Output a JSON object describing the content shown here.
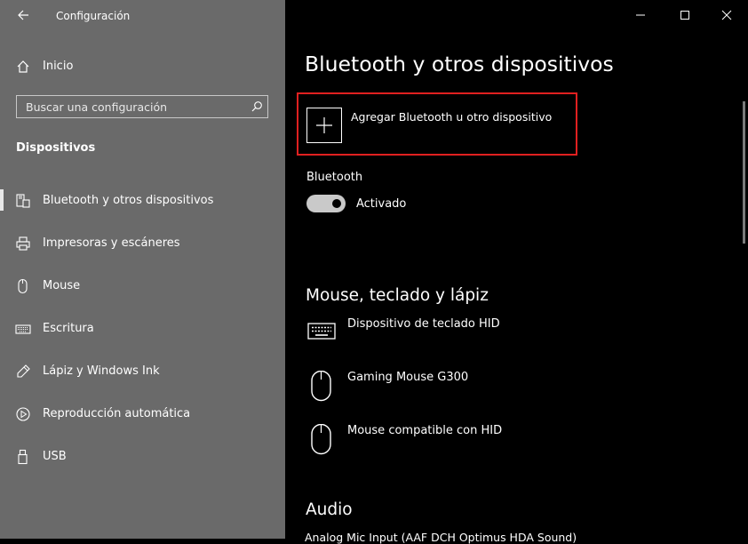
{
  "app": {
    "title": "Configuración",
    "back_icon": "back-arrow-icon",
    "window_controls": [
      "minimize-icon",
      "maximize-icon",
      "close-icon"
    ]
  },
  "sidebar": {
    "home_label": "Inicio",
    "search": {
      "placeholder": "Buscar una configuración",
      "value": ""
    },
    "section_header": "Dispositivos",
    "items": [
      {
        "label": "Bluetooth y otros dispositivos",
        "icon": "bluetooth-devices-icon",
        "selected": true
      },
      {
        "label": "Impresoras y escáneres",
        "icon": "printer-icon",
        "selected": false
      },
      {
        "label": "Mouse",
        "icon": "mouse-icon",
        "selected": false
      },
      {
        "label": "Escritura",
        "icon": "keyboard-icon",
        "selected": false
      },
      {
        "label": "Lápiz y Windows Ink",
        "icon": "pen-icon",
        "selected": false
      },
      {
        "label": "Reproducción automática",
        "icon": "autoplay-icon",
        "selected": false
      },
      {
        "label": "USB",
        "icon": "usb-icon",
        "selected": false
      }
    ]
  },
  "main": {
    "page_title": "Bluetooth y otros dispositivos",
    "add_device_label": "Agregar Bluetooth u otro dispositivo",
    "bluetooth_label": "Bluetooth",
    "bluetooth_state": "Activado",
    "bluetooth_on": true,
    "groups": {
      "input_title": "Mouse, teclado y lápiz",
      "devices": [
        {
          "name": "Dispositivo de teclado HID",
          "icon": "keyboard-icon"
        },
        {
          "name": "Gaming Mouse G300",
          "icon": "mouse-icon"
        },
        {
          "name": "Mouse compatible con HID",
          "icon": "mouse-icon"
        }
      ],
      "audio_title": "Audio",
      "audio_partial": "Analog Mic Input (AAF DCH Optimus HDA Sound)"
    }
  },
  "colors": {
    "sidebar_bg": "#6a6a6a",
    "main_bg": "#000000",
    "highlight_border": "#e02020"
  }
}
